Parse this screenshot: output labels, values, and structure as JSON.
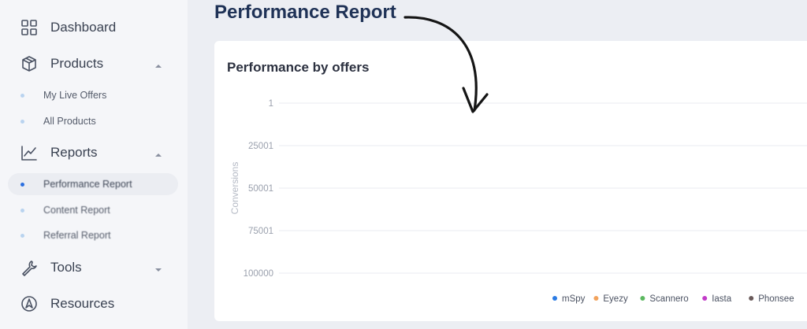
{
  "sidebar": {
    "items": [
      {
        "label": "Dashboard",
        "icon": "grid-icon"
      },
      {
        "label": "Products",
        "icon": "box-icon",
        "expanded": true
      },
      {
        "label": "Reports",
        "icon": "chart-line-icon",
        "expanded": true
      },
      {
        "label": "Tools",
        "icon": "wrench-icon",
        "expanded": false
      },
      {
        "label": "Resources",
        "icon": "compass-icon"
      }
    ],
    "products_sub": [
      "My Live Offers",
      "All Products"
    ],
    "reports_sub": [
      "Performance Report",
      "Content Report",
      "Referral Report"
    ]
  },
  "page": {
    "title": "Performance Report"
  },
  "card": {
    "title": "Performance by offers"
  },
  "colors": {
    "active_dot": "#2b6fe0",
    "title": "#1f3256"
  },
  "chart_data": {
    "type": "line",
    "title": "Performance by offers",
    "xlabel": "",
    "ylabel": "Conversions",
    "y_ticks": [
      "1",
      "25001",
      "50001",
      "75001",
      "100000"
    ],
    "ylim": [
      1,
      100000
    ],
    "y_reversed": true,
    "grid": true,
    "legend_position": "bottom-right",
    "series": [
      {
        "name": "mSpy",
        "color": "#2b7be4",
        "values": []
      },
      {
        "name": "Eyezy",
        "color": "#f2a25c",
        "values": []
      },
      {
        "name": "Scannero",
        "color": "#5cb860",
        "values": []
      },
      {
        "name": "Iasta",
        "color": "#c23bc8",
        "values": []
      },
      {
        "name": "Phonsee",
        "color": "#6a5a5a",
        "values": []
      }
    ]
  }
}
